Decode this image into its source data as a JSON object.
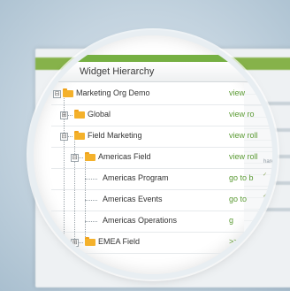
{
  "panel": {
    "title": "Widget Hierarchy"
  },
  "tree": {
    "items": [
      {
        "label": "Marketing Org Demo",
        "action": "view",
        "expander": "⊟"
      },
      {
        "label": "Global",
        "action": "view ro",
        "expander": "⊞"
      },
      {
        "label": "Field Marketing",
        "action": "view roll",
        "expander": "⊟"
      },
      {
        "label": "Americas Field",
        "action": "view roll",
        "expander": "⊟"
      },
      {
        "label": "Americas Program",
        "action": "go to b"
      },
      {
        "label": "Americas Events",
        "action": "go to"
      },
      {
        "label": "Americas Operations",
        "action": "g"
      },
      {
        "label": "EMEA Field",
        "action": ">>",
        "expander": "⊞"
      }
    ]
  },
  "side": {
    "share_label": "hare"
  },
  "colors": {
    "accent_green": "#76b043",
    "folder_orange": "#f4b12b",
    "action_green": "#5a9a33"
  }
}
